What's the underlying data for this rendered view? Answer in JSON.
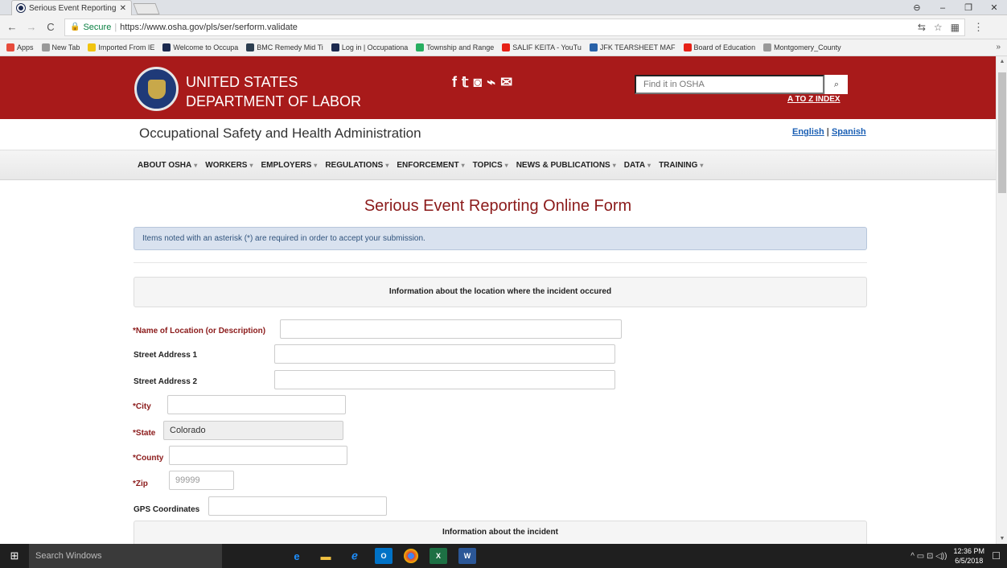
{
  "browser": {
    "tab_title": "Serious Event Reporting ·",
    "tab_close": "✕",
    "url_secure_label": "Secure",
    "url": "https://www.osha.gov/pls/ser/serform.validate",
    "win_min": "–",
    "win_max": "❐",
    "win_close": "✕",
    "profile": "⊖"
  },
  "bookmarks": [
    {
      "label": "Apps",
      "color": "#e74c3c"
    },
    {
      "label": "New Tab",
      "color": "#999999"
    },
    {
      "label": "Imported From IE",
      "color": "#f1c40f"
    },
    {
      "label": "Welcome to Occupa",
      "color": "#1c2a4f"
    },
    {
      "label": "BMC Remedy Mid Ti",
      "color": "#2c3e50"
    },
    {
      "label": "Log in | Occupationa",
      "color": "#1c2a4f"
    },
    {
      "label": "Township and Range",
      "color": "#27ae60"
    },
    {
      "label": "SALIF KEITA - YouTu",
      "color": "#e62117"
    },
    {
      "label": "JFK TEARSHEET MAF",
      "color": "#2962a8"
    },
    {
      "label": "Board of Education",
      "color": "#e62117"
    },
    {
      "label": "Montgomery_County",
      "color": "#999999"
    }
  ],
  "bookmarks_more": "»",
  "site": {
    "dept_line1": "UNITED STATES",
    "dept_line2": "DEPARTMENT OF LABOR",
    "social": [
      "f",
      "🐦",
      "◙",
      "⌁",
      "✉"
    ],
    "search_placeholder": "Find it in OSHA",
    "search_btn": "🔍",
    "atoz": "A TO Z INDEX",
    "agency": "Occupational Safety and Health Administration",
    "lang_en": "English",
    "lang_sep": " | ",
    "lang_es": "Spanish",
    "nav": [
      "ABOUT OSHA",
      "WORKERS",
      "EMPLOYERS",
      "REGULATIONS",
      "ENFORCEMENT",
      "TOPICS",
      "NEWS & PUBLICATIONS",
      "DATA",
      "TRAINING"
    ],
    "nav_caret": "▾"
  },
  "form": {
    "title": "Serious Event Reporting Online Form",
    "notice": "Items noted with an asterisk (*) are required in order to accept your submission.",
    "section1": "Information about the location where the incident occured",
    "section2": "Information about the incident",
    "fields": {
      "location_name": {
        "label": "Name of Location (or Description)",
        "value": ""
      },
      "street1": {
        "label": "Street Address 1",
        "value": ""
      },
      "street2": {
        "label": "Street Address 2",
        "value": ""
      },
      "city": {
        "label": "City",
        "value": ""
      },
      "state": {
        "label": "State",
        "value": "Colorado"
      },
      "county": {
        "label": "County",
        "value": ""
      },
      "zip": {
        "label": "Zip",
        "placeholder": "99999",
        "value": ""
      },
      "gps": {
        "label": "GPS Coordinates",
        "value": ""
      }
    },
    "asterisk": "*"
  },
  "taskbar": {
    "search_placeholder": "Search Windows",
    "time": "12:36 PM",
    "date": "6/5/2018",
    "tray_icons": "^ ▭ ⊡ ◁))"
  }
}
